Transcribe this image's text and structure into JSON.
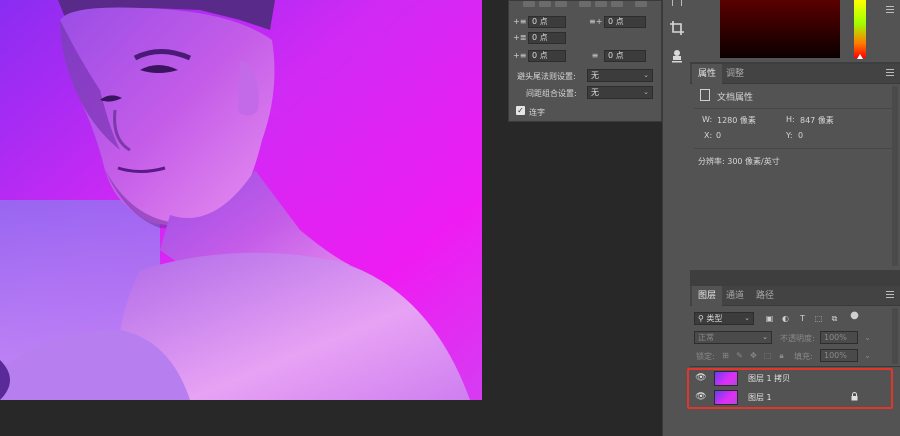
{
  "colors": {
    "panel_bg": "#535353",
    "app_bg": "#282828",
    "highlight": "#e0362b"
  },
  "paragraph_panel": {
    "inputs": {
      "indent_left": "0 点",
      "indent_right": "0 点",
      "indent_first": "0 点",
      "space_before": "0 点",
      "space_after": "0 点"
    },
    "kinsoku_label": "避头尾法则设置:",
    "kinsoku_value": "无",
    "mojikumi_label": "间距组合设置:",
    "mojikumi_value": "无",
    "hyphenate_label": "连字",
    "hyphenate_checked": true
  },
  "properties_panel": {
    "tabs": [
      "属性",
      "调整"
    ],
    "doc_title": "文档属性",
    "w_label": "W:",
    "w_value": "1280 像素",
    "h_label": "H:",
    "h_value": "847 像素",
    "x_label": "X:",
    "x_value": "0",
    "y_label": "Y:",
    "y_value": "0",
    "resolution": "分辨率: 300 像素/英寸"
  },
  "layers_panel": {
    "tabs": [
      "图层",
      "通道",
      "路径"
    ],
    "filter_kind": "类型",
    "blend_mode": "正常",
    "opacity_label": "不透明度:",
    "opacity_value": "100%",
    "lock_label": "锁定:",
    "fill_label": "填充:",
    "fill_value": "100%",
    "layers": [
      {
        "name": "图层 1 拷贝",
        "visible": true,
        "locked": false
      },
      {
        "name": "图层 1",
        "visible": true,
        "locked": true
      }
    ]
  },
  "tool_icons": [
    "crop-icon",
    "stamp-icon"
  ]
}
